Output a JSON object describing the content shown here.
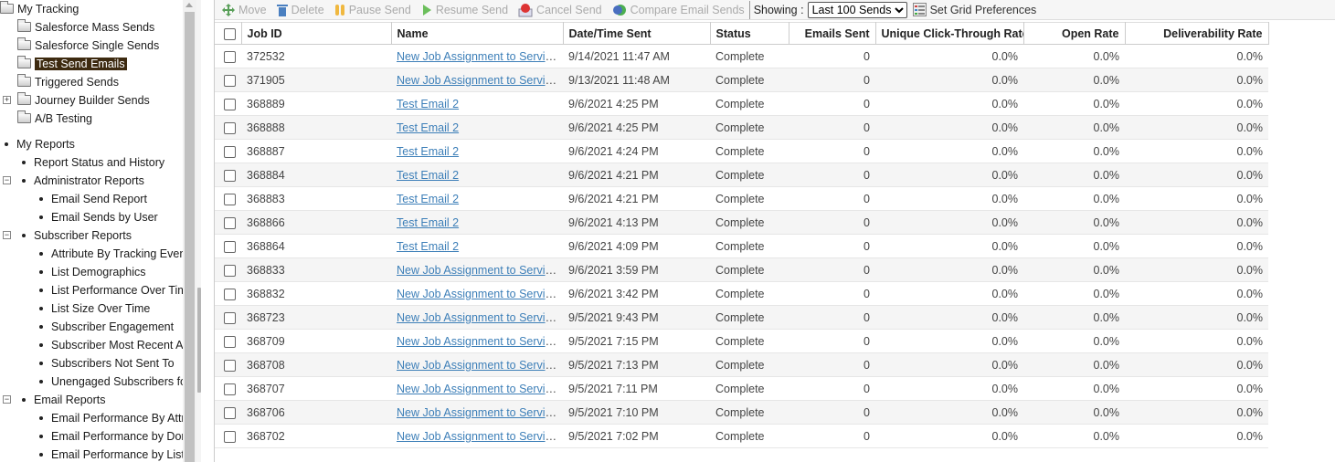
{
  "sidebar": {
    "tracking": {
      "label": "My Tracking",
      "items": [
        {
          "label": "Salesforce Mass Sends"
        },
        {
          "label": "Salesforce Single Sends"
        },
        {
          "label": "Test Send Emails",
          "selected": true
        },
        {
          "label": "Triggered Sends"
        },
        {
          "label": "Journey Builder Sends",
          "expandable": true
        },
        {
          "label": "A/B Testing"
        }
      ]
    },
    "reports": {
      "label": "My Reports",
      "report_status": "Report Status and History",
      "groups": [
        {
          "label": "Administrator Reports",
          "items": [
            "Email Send Report",
            "Email Sends by User"
          ]
        },
        {
          "label": "Subscriber Reports",
          "items": [
            "Attribute By Tracking Event",
            "List Demographics",
            "List Performance Over Tim",
            "List Size Over Time",
            "Subscriber Engagement",
            "Subscriber Most Recent Ac",
            "Subscribers Not Sent To",
            "Unengaged Subscribers fo"
          ]
        },
        {
          "label": "Email Reports",
          "items": [
            "Email Performance By Attri",
            "Email Performance by Don",
            "Email Performance by List"
          ]
        }
      ]
    }
  },
  "toolbar": {
    "move": "Move",
    "delete": "Delete",
    "pause": "Pause Send",
    "resume": "Resume Send",
    "cancel": "Cancel Send",
    "compare": "Compare Email Sends",
    "showing_label": "Showing :",
    "showing_value": "Last 100 Sends",
    "grid_prefs": "Set Grid Preferences"
  },
  "table": {
    "headers": [
      "Job ID",
      "Name",
      "Date/Time Sent",
      "Status",
      "Emails Sent",
      "Unique Click-Through Rate",
      "Open Rate",
      "Deliverability Rate"
    ],
    "rows": [
      [
        "372532",
        "New Job Assignment to Servic...",
        "9/14/2021 11:47 AM",
        "Complete",
        "0",
        "0.0%",
        "0.0%",
        "0.0%"
      ],
      [
        "371905",
        "New Job Assignment to Servic...",
        "9/13/2021 11:48 AM",
        "Complete",
        "0",
        "0.0%",
        "0.0%",
        "0.0%"
      ],
      [
        "368889",
        "Test Email 2",
        "9/6/2021 4:25 PM",
        "Complete",
        "0",
        "0.0%",
        "0.0%",
        "0.0%"
      ],
      [
        "368888",
        "Test Email 2",
        "9/6/2021 4:25 PM",
        "Complete",
        "0",
        "0.0%",
        "0.0%",
        "0.0%"
      ],
      [
        "368887",
        "Test Email 2",
        "9/6/2021 4:24 PM",
        "Complete",
        "0",
        "0.0%",
        "0.0%",
        "0.0%"
      ],
      [
        "368884",
        "Test Email 2",
        "9/6/2021 4:21 PM",
        "Complete",
        "0",
        "0.0%",
        "0.0%",
        "0.0%"
      ],
      [
        "368883",
        "Test Email 2",
        "9/6/2021 4:21 PM",
        "Complete",
        "0",
        "0.0%",
        "0.0%",
        "0.0%"
      ],
      [
        "368866",
        "Test Email 2",
        "9/6/2021 4:13 PM",
        "Complete",
        "0",
        "0.0%",
        "0.0%",
        "0.0%"
      ],
      [
        "368864",
        "Test Email 2",
        "9/6/2021 4:09 PM",
        "Complete",
        "0",
        "0.0%",
        "0.0%",
        "0.0%"
      ],
      [
        "368833",
        "New Job Assignment to Servic...",
        "9/6/2021 3:59 PM",
        "Complete",
        "0",
        "0.0%",
        "0.0%",
        "0.0%"
      ],
      [
        "368832",
        "New Job Assignment to Servic...",
        "9/6/2021 3:42 PM",
        "Complete",
        "0",
        "0.0%",
        "0.0%",
        "0.0%"
      ],
      [
        "368723",
        "New Job Assignment to Servic...",
        "9/5/2021 9:43 PM",
        "Complete",
        "0",
        "0.0%",
        "0.0%",
        "0.0%"
      ],
      [
        "368709",
        "New Job Assignment to Servic...",
        "9/5/2021 7:15 PM",
        "Complete",
        "0",
        "0.0%",
        "0.0%",
        "0.0%"
      ],
      [
        "368708",
        "New Job Assignment to Servic...",
        "9/5/2021 7:13 PM",
        "Complete",
        "0",
        "0.0%",
        "0.0%",
        "0.0%"
      ],
      [
        "368707",
        "New Job Assignment to Servic...",
        "9/5/2021 7:11 PM",
        "Complete",
        "0",
        "0.0%",
        "0.0%",
        "0.0%"
      ],
      [
        "368706",
        "New Job Assignment to Servic...",
        "9/5/2021 7:10 PM",
        "Complete",
        "0",
        "0.0%",
        "0.0%",
        "0.0%"
      ],
      [
        "368702",
        "New Job Assignment to Servic...",
        "9/5/2021 7:02 PM",
        "Complete",
        "0",
        "0.0%",
        "0.0%",
        "0.0%"
      ]
    ]
  },
  "colors": {
    "selected_bg": "#3d2a10",
    "link": "#3d7fb8",
    "alt_row": "#f5f5f5"
  }
}
